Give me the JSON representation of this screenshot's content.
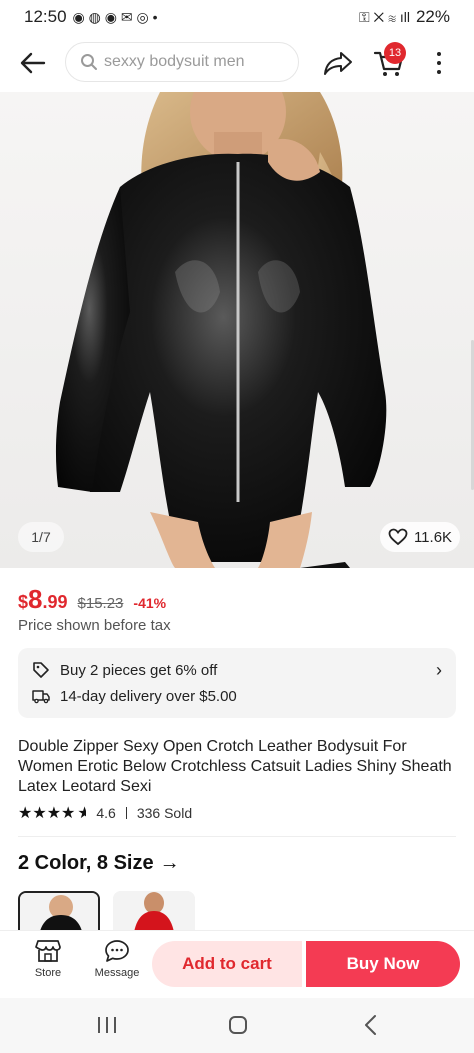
{
  "status_bar": {
    "time": "12:50",
    "battery": "22%"
  },
  "search": {
    "query": "sexxy bodysuit men"
  },
  "cart": {
    "count": "13"
  },
  "gallery": {
    "counter": "1/7",
    "likes": "11.6K"
  },
  "price": {
    "currency": "$",
    "integer": "8",
    "decimal": ".99",
    "original": "$15.23",
    "discount": "-41%",
    "tax_note": "Price shown before tax"
  },
  "promo": {
    "offer": "Buy 2 pieces get 6% off",
    "delivery": "14-day delivery over $5.00"
  },
  "product": {
    "title": "Double Zipper Sexy Open Crotch Leather Bodysuit For Women Erotic Below Crotchless Catsuit Ladies Shiny Sheath Latex Leotard Sexi",
    "rating": "4.6",
    "rating_value": 4.6,
    "sold": "336 Sold"
  },
  "variants": {
    "label": "2 Color, 8 Size",
    "colors": [
      "black",
      "red"
    ]
  },
  "bottom_bar": {
    "store_label": "Store",
    "message_label": "Message",
    "add_to_cart_label": "Add to cart",
    "buy_now_label": "Buy Now"
  },
  "colors": {
    "accent": "#e0282e",
    "buy_button": "#f43b53",
    "cart_button_bg": "#ffe4e4"
  },
  "icons": [
    "back-arrow-icon",
    "search-icon",
    "share-icon",
    "cart-icon",
    "more-icon",
    "heart-icon",
    "tag-icon",
    "truck-icon",
    "chevron-right-icon",
    "store-icon",
    "message-icon"
  ]
}
